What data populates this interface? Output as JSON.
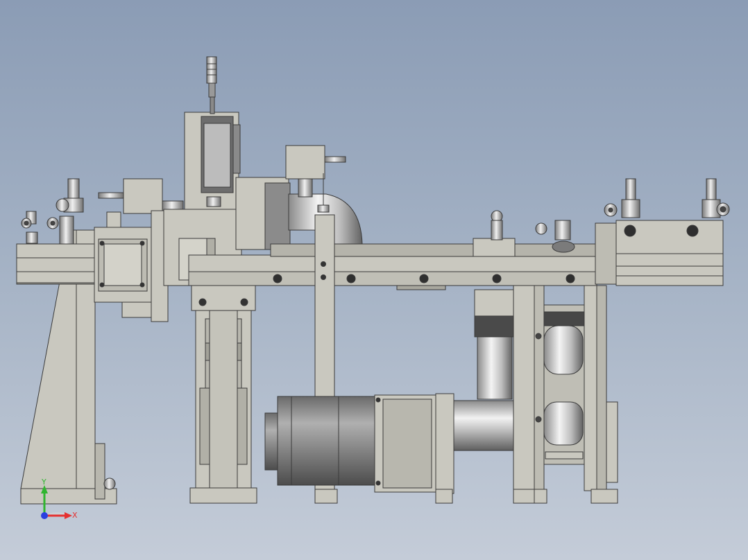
{
  "triad": {
    "x_label": "X",
    "y_label": "Y",
    "x_color": "#e53030",
    "y_color": "#2fb52f",
    "z_color": "#2b3fe0"
  },
  "colors": {
    "part_fill": "#c9c8bf",
    "part_stroke": "#3a3a3a",
    "metal_light": "#e8e8e8",
    "metal_dark": "#6f6f6f",
    "motor_dark": "#5a5a5a"
  }
}
